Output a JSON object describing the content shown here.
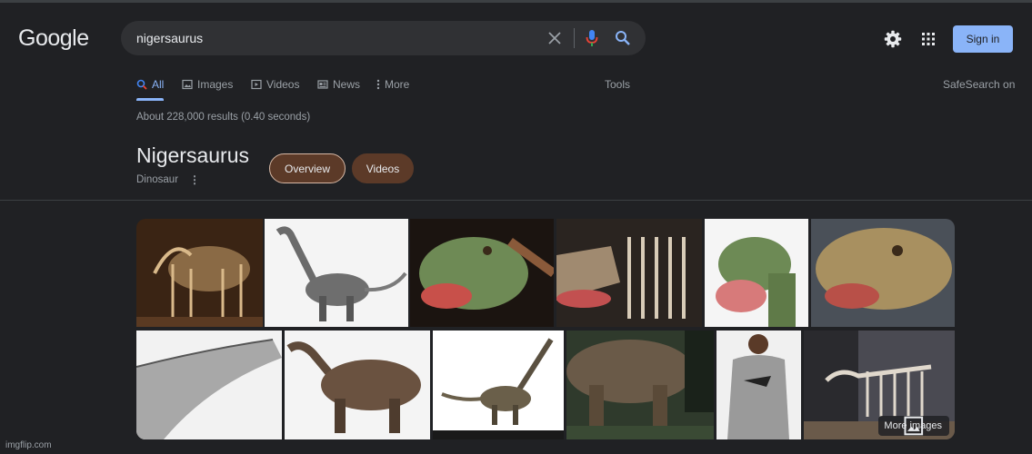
{
  "header": {
    "logo": "Google",
    "query": "nigersaurus",
    "signin_label": "Sign in"
  },
  "icons": {
    "clear": "close-icon",
    "voice": "microphone-icon",
    "search": "search-icon",
    "settings": "gear-icon",
    "apps": "apps-grid-icon"
  },
  "tabs": {
    "all": "All",
    "images": "Images",
    "videos": "Videos",
    "news": "News",
    "more": "More",
    "tools": "Tools",
    "safesearch": "SafeSearch on"
  },
  "stats": "About 228,000 results (0.40 seconds)",
  "knowledge": {
    "title": "Nigersaurus",
    "subtitle": "Dinosaur",
    "chips": [
      "Overview",
      "Videos"
    ]
  },
  "images": {
    "more_label": "More images",
    "thumbnails": [
      "skeleton-thumbnail-1",
      "sauropod-render-thumbnail",
      "head-closeup-thumbnail",
      "skull-skeleton-thumbnail",
      "head-render-thumbnail",
      "head-closeup-thumbnail-2",
      "neck-sketch-thumbnail",
      "body-render-thumbnail",
      "full-body-thumbnail",
      "jurassic-world-thumbnail",
      "hoodie-product-thumbnail",
      "skeleton-thumbnail-2"
    ]
  },
  "footer": {
    "watermark": "imgflip.com"
  },
  "colors": {
    "background": "#202124",
    "accent": "#8ab4f8",
    "chip": "#5c3a28"
  }
}
